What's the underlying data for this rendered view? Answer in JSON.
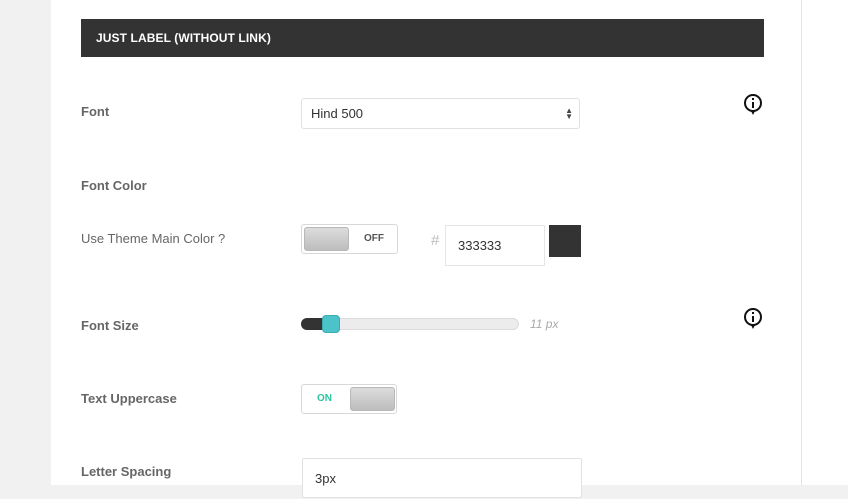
{
  "section": {
    "title": "JUST LABEL (WITHOUT LINK)"
  },
  "fields": {
    "font": {
      "label": "Font",
      "value": "Hind 500",
      "info_icon": "info-icon"
    },
    "font_color": {
      "label": "Font Color"
    },
    "theme_color": {
      "label": "Use Theme Main Color ?",
      "toggle_state": "OFF",
      "hash": "#",
      "hex_value": "333333",
      "swatch_color": "#333333"
    },
    "font_size": {
      "label": "Font Size",
      "value_text": "11 px",
      "slider_fraction": 0.135,
      "info_icon": "info-icon"
    },
    "uppercase": {
      "label": "Text Uppercase",
      "toggle_state": "ON",
      "on_color": "#2ec4a0"
    },
    "letter_spacing": {
      "label": "Letter Spacing",
      "value": "3px"
    }
  }
}
